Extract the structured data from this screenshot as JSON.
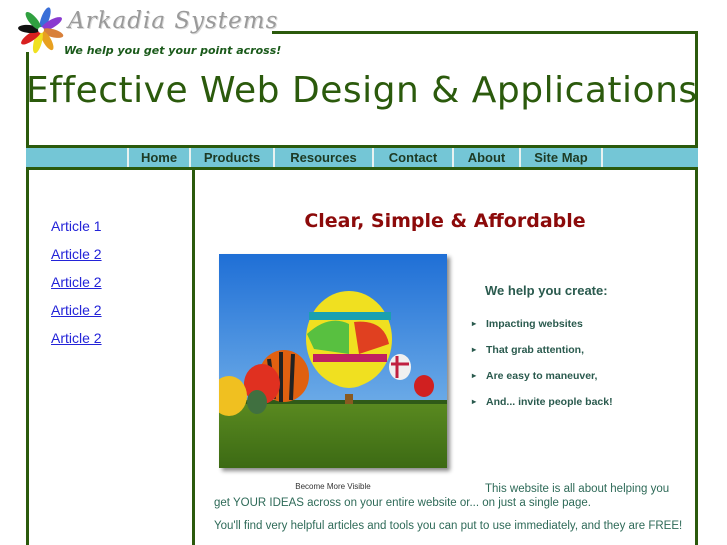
{
  "logo": {
    "name": "Arkadia Systems",
    "tagline": "We help you get your point across!",
    "petal_colors": [
      "#3a6fd8",
      "#8a3ad0",
      "#d8402a",
      "#e8a020",
      "#f0e020",
      "#30a040",
      "#20a0c0",
      "#111111"
    ]
  },
  "header": {
    "headline": "Effective Web Design & Applications"
  },
  "nav": {
    "items": [
      {
        "label": "Home"
      },
      {
        "label": "Products"
      },
      {
        "label": "Resources"
      },
      {
        "label": "Contact"
      },
      {
        "label": "About"
      },
      {
        "label": "Site Map"
      }
    ]
  },
  "sidebar": {
    "articles": [
      {
        "label": "Article 1"
      },
      {
        "label": "Article 2"
      },
      {
        "label": "Article 2"
      },
      {
        "label": "Article 2"
      },
      {
        "label": "Article 2"
      }
    ]
  },
  "main": {
    "tagline": "Clear, Simple & Affordable",
    "photo_alt": "hot-air-balloons",
    "photo_caption": "Become More Visible",
    "help_title": "We help you create:",
    "help_items": [
      "Impacting websites",
      "That grab attention,",
      "Are easy to maneuver,",
      "And... invite people back!"
    ],
    "intro_line_1": "This website is all about helping you",
    "intro_line_2": "get YOUR IDEAS across on your entire website or... on just a single page.",
    "intro_line_3": "You'll find very helpful articles and tools you can put to use immediately, and they are FREE!"
  },
  "colors": {
    "frame": "#2b5a0c",
    "nav_bg": "#74c6d6",
    "tagline": "#8c0a0a",
    "link": "#2323d8",
    "body_text": "#2e6a58"
  }
}
